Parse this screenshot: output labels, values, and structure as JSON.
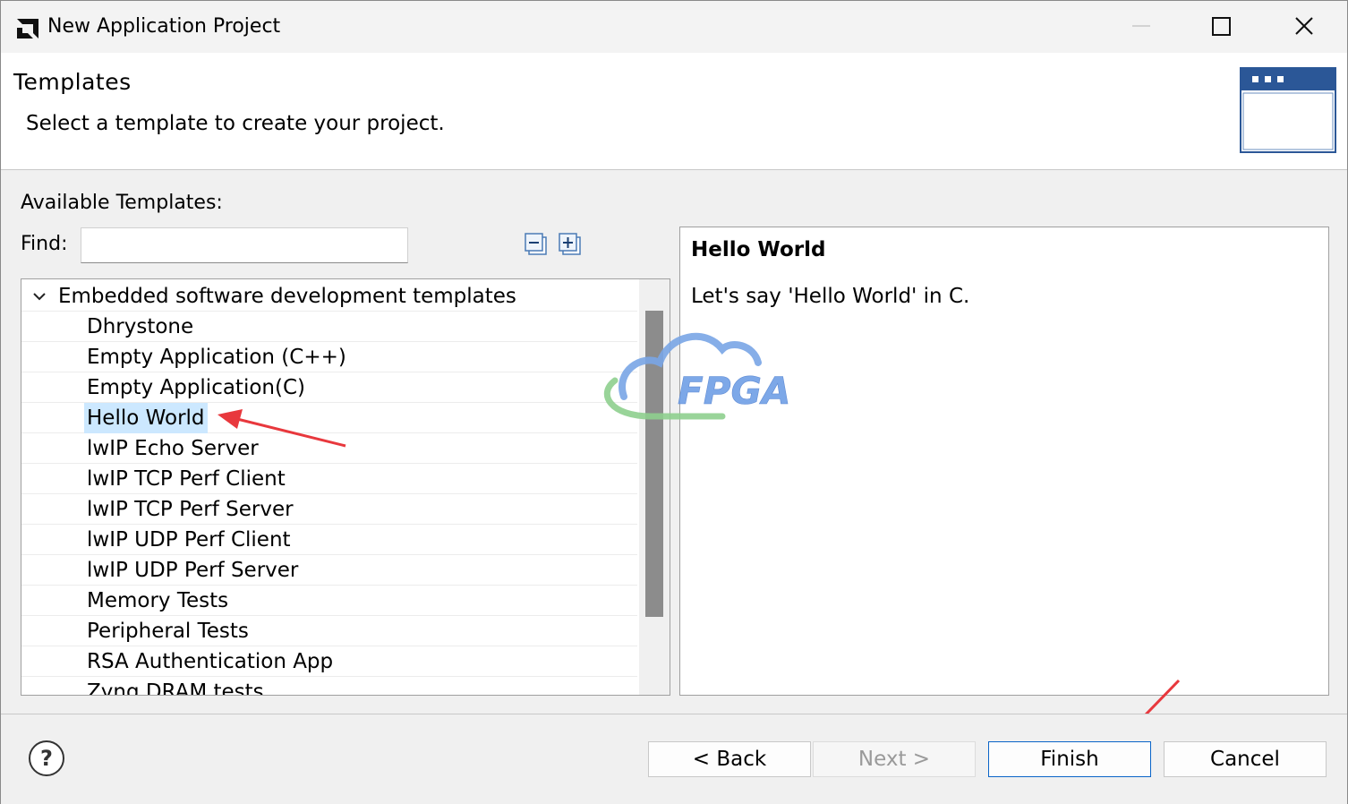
{
  "window": {
    "title": "New Application Project",
    "logo_icon": "amd-logo-icon",
    "controls": [
      "minimize-icon",
      "maximize-icon",
      "close-icon"
    ]
  },
  "header": {
    "title": "Templates",
    "subtitle": "Select a template to create your project.",
    "banner_icon": "wizard-window-icon"
  },
  "templates": {
    "available_label": "Available Templates:",
    "find_label": "Find:",
    "find_value": "",
    "collapse_icon": "collapse-all-icon",
    "expand_icon": "expand-all-icon",
    "category": "Embedded software development templates",
    "items": [
      "Dhrystone",
      "Empty Application (C++)",
      "Empty Application(C)",
      "Hello World",
      "lwIP Echo Server",
      "lwIP TCP Perf Client",
      "lwIP TCP Perf Server",
      "lwIP UDP Perf Client",
      "lwIP UDP Perf Server",
      "Memory Tests",
      "Peripheral Tests",
      "RSA Authentication App",
      "Zynq DRAM tests"
    ],
    "selected": "Hello World"
  },
  "description": {
    "title": "Hello World",
    "text": "Let's say 'Hello World' in C."
  },
  "watermark": {
    "text": "FPGA",
    "icon": "cloud-logo-icon"
  },
  "footer": {
    "help_icon": "help-icon",
    "back_label": "< Back",
    "next_label": "Next >",
    "finish_label": "Finish",
    "cancel_label": "Cancel"
  },
  "colors": {
    "selection": "#cce8ff",
    "annotation_arrow": "#e8383d",
    "default_button_border": "#0a64c8"
  }
}
